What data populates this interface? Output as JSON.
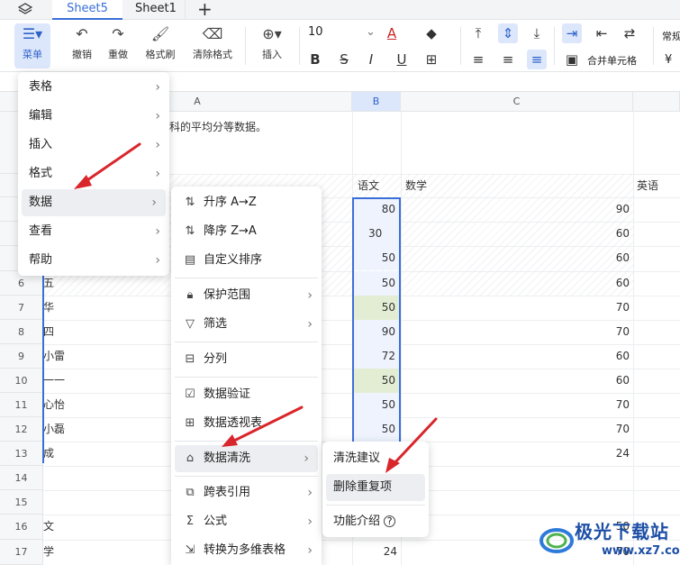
{
  "tabs": {
    "active": "Sheet5",
    "other": "Sheet1",
    "add": "+"
  },
  "toolbar": {
    "menu": "菜单",
    "undo": "撤销",
    "redo": "重做",
    "painter": "格式刷",
    "clear_format": "清除格式",
    "insert": "插入",
    "font_size": "10",
    "merge": "合并单元格",
    "regular": "常规",
    "currency": "¥"
  },
  "columns": {
    "a": "A",
    "b": "B",
    "c": "C"
  },
  "rows": [
    {
      "num": "6",
      "a": "五",
      "b": "50",
      "c": "60"
    },
    {
      "num": "7",
      "a": "华",
      "b": "50",
      "c": "70"
    },
    {
      "num": "8",
      "a": "四",
      "b": "90",
      "c": "70"
    },
    {
      "num": "9",
      "a": "小雷",
      "b": "72",
      "c": "60"
    },
    {
      "num": "10",
      "a": "一一",
      "b": "50",
      "c": "60"
    },
    {
      "num": "11",
      "a": "心怡",
      "b": "50",
      "c": "70"
    },
    {
      "num": "12",
      "a": "小磊",
      "b": "50",
      "c": "70"
    },
    {
      "num": "13",
      "a": "成",
      "b": "",
      "c": "24"
    },
    {
      "num": "14",
      "a": "",
      "b": "",
      "c": ""
    },
    {
      "num": "15",
      "a": "",
      "b": "",
      "c": ""
    },
    {
      "num": "16",
      "a": "文",
      "b": "",
      "c": "50"
    },
    {
      "num": "17",
      "a": "学",
      "b": "24",
      "c": "70"
    }
  ],
  "top_rows": [
    {
      "b": "80",
      "c": "90"
    },
    {
      "b": "30",
      "c": "60"
    },
    {
      "b": "50",
      "c": "60"
    }
  ],
  "cells": {
    "note": "科的平均分等数据。",
    "hdr_chinese": "语文",
    "hdr_math": "数学",
    "hdr_english": "英语"
  },
  "main_menu": [
    "表格",
    "编辑",
    "插入",
    "格式",
    "数据",
    "查看",
    "帮助"
  ],
  "data_menu": {
    "sort_asc": "升序 A→Z",
    "sort_desc": "降序 Z→A",
    "custom_sort": "自定义排序",
    "protect": "保护范围",
    "filter": "筛选",
    "split": "分列",
    "validate": "数据验证",
    "pivot": "数据透视表",
    "clean": "数据清洗",
    "cross_ref": "跨表引用",
    "formula": "公式",
    "to_multi": "转换为多维表格"
  },
  "clean_menu": {
    "suggest": "清洗建议",
    "remove_dup": "删除重复项",
    "intro": "功能介绍"
  },
  "watermark": {
    "text": "极光下载站",
    "url": "www.xz7.com"
  },
  "colors": {
    "accent": "#3a6fd8",
    "arrow": "#d9262c",
    "green_cell": "#e3edd3"
  }
}
